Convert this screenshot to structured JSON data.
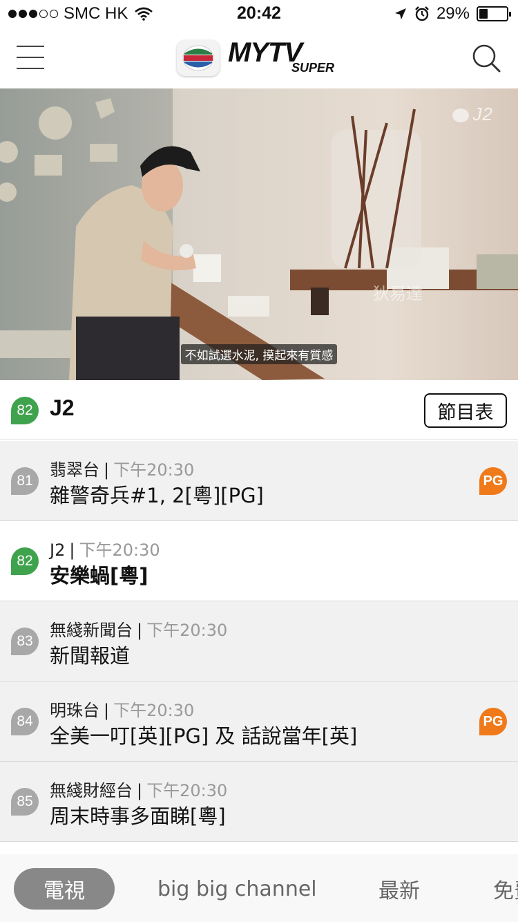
{
  "status_bar": {
    "carrier": "SMC HK",
    "time": "20:42",
    "battery": "29%",
    "battery_level": 0.29
  },
  "header": {
    "logo_main": "MYTV",
    "logo_sub": "SUPER"
  },
  "player": {
    "subtitle": "不如試選水泥, 摸起來有質感",
    "watermark": "J2"
  },
  "current_channel": {
    "number": "82",
    "name": "J2",
    "schedule_button": "節目表"
  },
  "channels": [
    {
      "number": "81",
      "channel": "翡翠台",
      "time": "下午20:30",
      "program": "雜警奇兵#1, 2[粵][PG]",
      "pg": "PG",
      "active": false
    },
    {
      "number": "82",
      "channel": "J2",
      "time": "下午20:30",
      "program": "安樂蝸[粵]",
      "pg": "",
      "active": true
    },
    {
      "number": "83",
      "channel": "無綫新聞台",
      "time": "下午20:30",
      "program": "新聞報道",
      "pg": "",
      "active": false
    },
    {
      "number": "84",
      "channel": "明珠台",
      "time": "下午20:30",
      "program": "全美一叮[英][PG] 及 話說當年[英]",
      "pg": "PG",
      "active": false
    },
    {
      "number": "85",
      "channel": "無綫財經台",
      "time": "下午20:30",
      "program": "周末時事多面睇[粵]",
      "pg": "",
      "active": false
    }
  ],
  "bottom_tabs": [
    {
      "label": "電視",
      "selected": true
    },
    {
      "label": "big big channel",
      "selected": false
    },
    {
      "label": "最新",
      "selected": false
    },
    {
      "label": "免費",
      "selected": false
    }
  ],
  "colors": {
    "active_channel": "#3fa34d",
    "inactive_channel": "#a8a8a8",
    "pg_badge": "#f07a1a",
    "tab_selected": "#888888"
  }
}
